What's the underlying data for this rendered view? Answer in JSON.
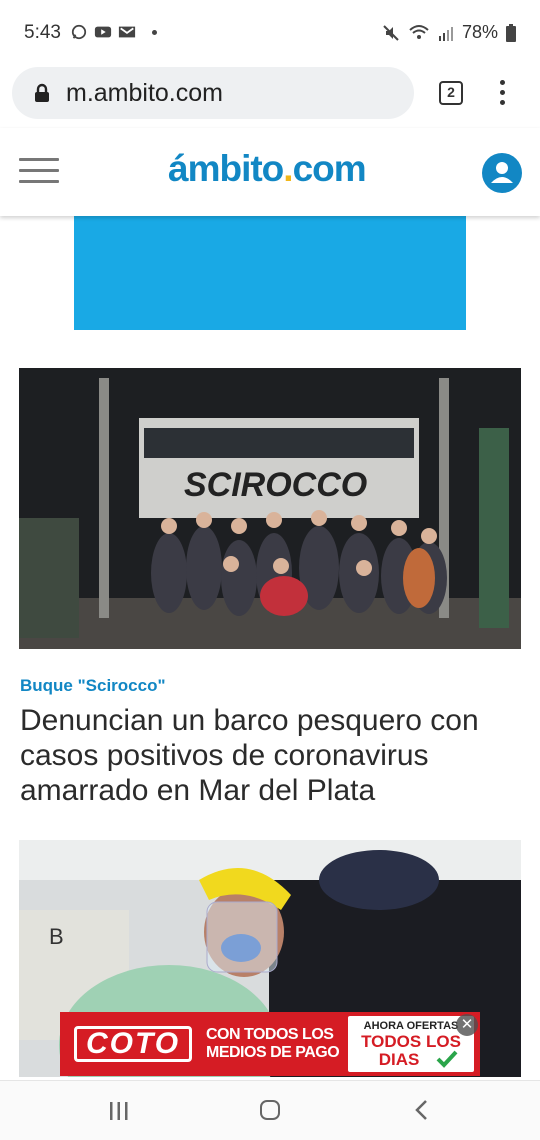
{
  "status_bar": {
    "time": "5:43",
    "battery": "78%",
    "left_icons": [
      "whatsapp-icon",
      "youtube-icon",
      "gmail-icon",
      "dot-icon"
    ],
    "right_icons": [
      "mute-icon",
      "wifi-icon",
      "signal-icon",
      "battery-icon"
    ]
  },
  "browser": {
    "url": "m.ambito.com",
    "tab_count": "2"
  },
  "site_header": {
    "logo_main": "ámbito",
    "logo_dot": ".",
    "logo_tld": "com",
    "brand_color": "#1287c4",
    "accent_color": "#f2b71a"
  },
  "ad_top": {
    "color": "#19a9e5"
  },
  "article_1": {
    "image_text": "SCIROCCO",
    "kicker": "Buque \"Scirocco\"",
    "headline": "Denuncian un barco pesquero con casos positivos de coronavirus amarrado en Mar del Plata"
  },
  "article_2": {
    "image_text": "B"
  },
  "coto_ad": {
    "logo": "COTO",
    "line1": "CON TODOS LOS",
    "line2": "MEDIOS DE PAGO",
    "offer_top": "AHORA OFERTAS",
    "offer_line1": "TODOS LOS",
    "offer_line2": "DIAS",
    "close": "✕"
  }
}
